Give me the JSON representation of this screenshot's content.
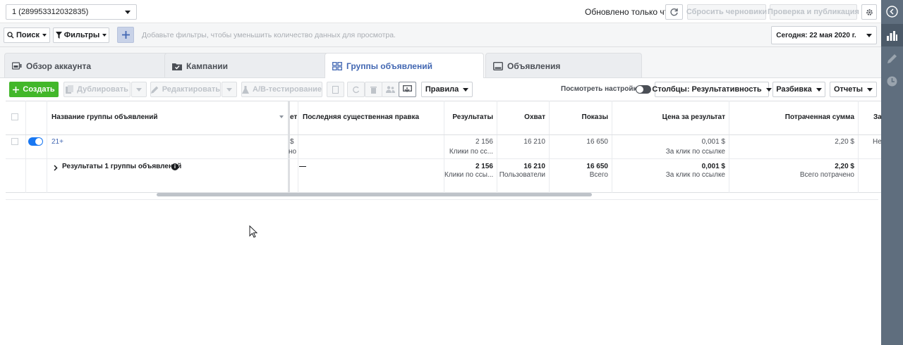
{
  "topbar": {
    "account_selector": "1 (289953312032835)",
    "updated_text": "Обновлено только что",
    "discard_button": "Сбросить черновики",
    "review_button": "Проверка и публикация"
  },
  "filterbar": {
    "search_label": "Поиск",
    "filters_label": "Фильтры",
    "placeholder": "Добавьте фильтры, чтобы уменьшить количество данных для просмотра.",
    "date_label": "Сегодня: 22 мая 2020 г."
  },
  "tabs": [
    {
      "label": "Обзор аккаунта"
    },
    {
      "label": "Кампании"
    },
    {
      "label": "Группы объявлений"
    },
    {
      "label": "Объявления"
    }
  ],
  "toolbar": {
    "create": "Создать",
    "duplicate": "Дублировать",
    "edit": "Редактировать",
    "ab_test": "A/B-тестирование",
    "rules": "Правила",
    "view_settings": "Посмотреть настройки",
    "columns": "Столбцы: Результативность",
    "breakdown": "Разбивка",
    "reports": "Отчеты"
  },
  "table": {
    "headers": {
      "name": "Название группы объявлений",
      "cut": "ет",
      "last_edit": "Последняя существенная правка",
      "results": "Результаты",
      "reach": "Охват",
      "impressions": "Показы",
      "cost_per_result": "Цена за результат",
      "amount_spent": "Потраченная сумма",
      "end": "За"
    },
    "row": {
      "name": "21+",
      "cut1": "$",
      "cut2": "но",
      "results": "2 156",
      "results_sub": "Клики по сс...",
      "reach": "16 210",
      "impressions": "16 650",
      "cost": "0,001 $",
      "cost_sub": "За клик по ссылке",
      "spent": "2,20 $",
      "end": "Не"
    },
    "summary": {
      "label": "Результаты 1 группы объявлений",
      "last_edit": "—",
      "results": "2 156",
      "results_sub": "Клики по ссы...",
      "reach": "16 210",
      "reach_sub": "Пользователи",
      "impressions": "16 650",
      "impressions_sub": "Всего",
      "cost": "0,001 $",
      "cost_sub": "За клик по ссылке",
      "spent": "2,20 $",
      "spent_sub": "Всего потрачено"
    }
  },
  "colors": {
    "accent": "#4267b2",
    "create_green": "#42b72a",
    "sidebar": "#5f6e7e"
  }
}
